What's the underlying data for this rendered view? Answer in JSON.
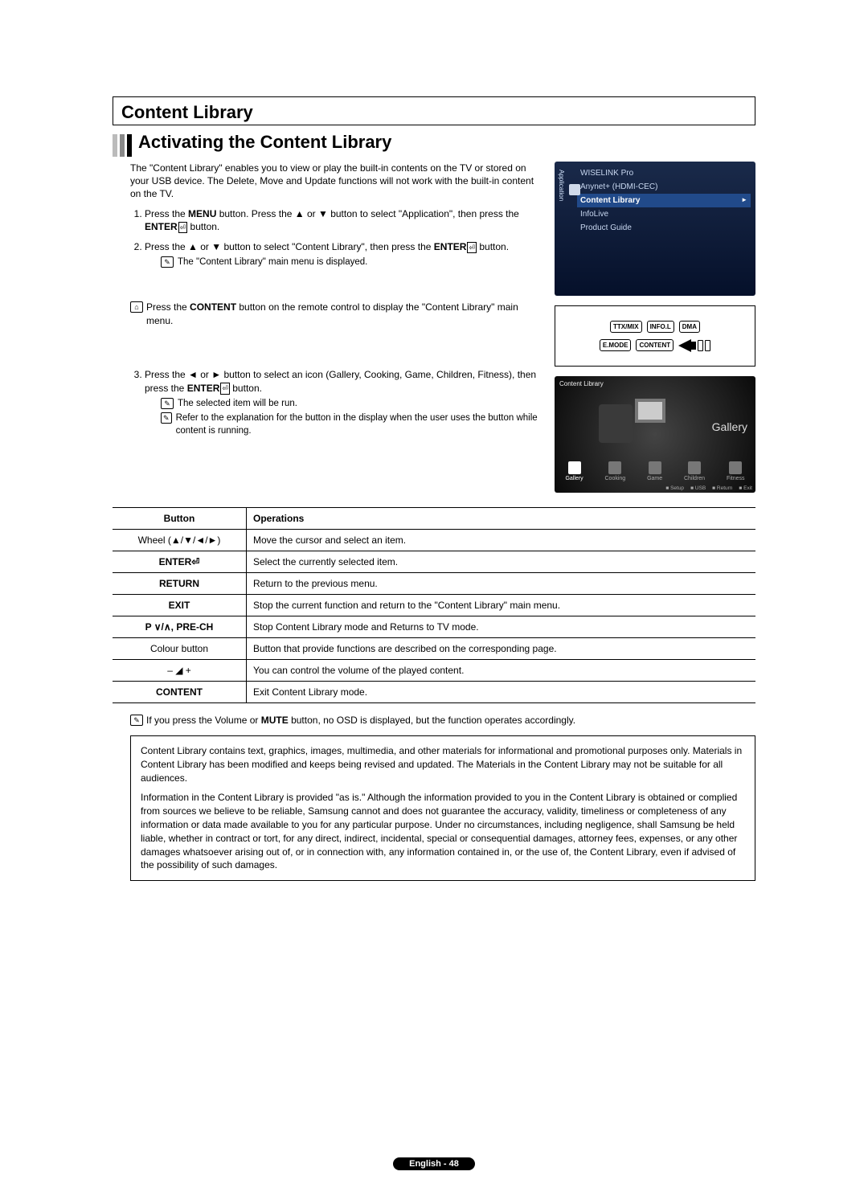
{
  "header": {
    "section": "Content Library",
    "subsection": "Activating the Content Library"
  },
  "intro": "The \"Content Library\" enables you to view or play the built-in contents on the TV or stored on your USB device. The Delete, Move and Update functions will not work with the built-in content on the TV.",
  "steps": {
    "s1a": "Press the ",
    "s1menu": "MENU",
    "s1b": " button. Press the ▲ or ▼ button to select \"Application\", then press the ",
    "s1enter": "ENTER",
    "s1c": " button.",
    "s2a": "Press the ▲ or ▼ button to select \"Content Library\", then press the ",
    "s2enter": "ENTER",
    "s2b": " button.",
    "s2note": "The \"Content Library\" main menu is displayed.",
    "remote_a": "Press the ",
    "remote_content": "CONTENT",
    "remote_b": " button on the remote control to display the \"Content Library\" main menu.",
    "s3a": "Press the ◄ or ► button to select an icon (Gallery, Cooking, Game, Children, Fitness), then press the ",
    "s3enter": "ENTER",
    "s3b": " button.",
    "s3note1": "The selected item will be run.",
    "s3note2": "Refer to the explanation for the button in the display when the user uses the button while content is running."
  },
  "tvmenu1": {
    "sidetab": "Application",
    "items": [
      "WISELINK Pro",
      "Anynet+ (HDMI-CEC)",
      "Content Library",
      "InfoLive",
      "Product Guide"
    ],
    "active": 2
  },
  "remoteButtons": {
    "row1": [
      "TTX/MIX",
      "INFO.L",
      "DMA"
    ],
    "row2": [
      "E.MODE",
      "CONTENT"
    ]
  },
  "tvmenu2": {
    "title": "Content Library",
    "bigLabel": "Gallery",
    "icons": [
      "Gallery",
      "Cooking",
      "Game",
      "Children",
      "Fitness"
    ],
    "bottom": [
      "Setup",
      "USB",
      "Return",
      "Exit"
    ]
  },
  "table": {
    "head": [
      "Button",
      "Operations"
    ],
    "rows": [
      [
        "Wheel (▲/▼/◄/►)",
        "Move the cursor and select an item."
      ],
      [
        "ENTER⏎",
        "Select the currently selected item."
      ],
      [
        "RETURN",
        "Return to the previous menu."
      ],
      [
        "EXIT",
        "Stop the current function and return to the \"Content Library\" main menu."
      ],
      [
        "P ∨/∧, PRE-CH",
        "Stop Content Library mode and Returns to TV mode."
      ],
      [
        "Colour button",
        "Button that provide functions are described on the corresponding page."
      ],
      [
        "– ◢ +",
        "You can control the volume of the played content."
      ],
      [
        "CONTENT",
        "Exit Content Library mode."
      ]
    ],
    "boldFirstCol": [
      false,
      true,
      true,
      true,
      true,
      false,
      false,
      true
    ]
  },
  "postnote_a": "If you press the Volume or ",
  "postnote_mute": "MUTE",
  "postnote_b": " button, no OSD is displayed, but the function operates accordingly.",
  "disclaimer": {
    "p1": "Content Library contains text, graphics, images, multimedia, and other materials for informational and promotional purposes only. Materials in Content Library has been modified and keeps being revised and updated.  The Materials in the Content Library may not be suitable for all audiences.",
    "p2": "Information in the Content Library is provided \"as is.\" Although the information provided to you in the Content Library is obtained or complied from sources we believe to be reliable, Samsung cannot and does not guarantee the accuracy, validity, timeliness or completeness of any information or data made available to you for any particular purpose. Under no circumstances, including negligence, shall Samsung be held liable, whether in contract or tort, for any direct, indirect, incidental, special or consequential damages, attorney fees, expenses, or any other damages whatsoever arising out of, or in connection with, any information contained in, or the use of, the Content Library, even if advised of the possibility of such damages."
  },
  "footer": "English - 48"
}
